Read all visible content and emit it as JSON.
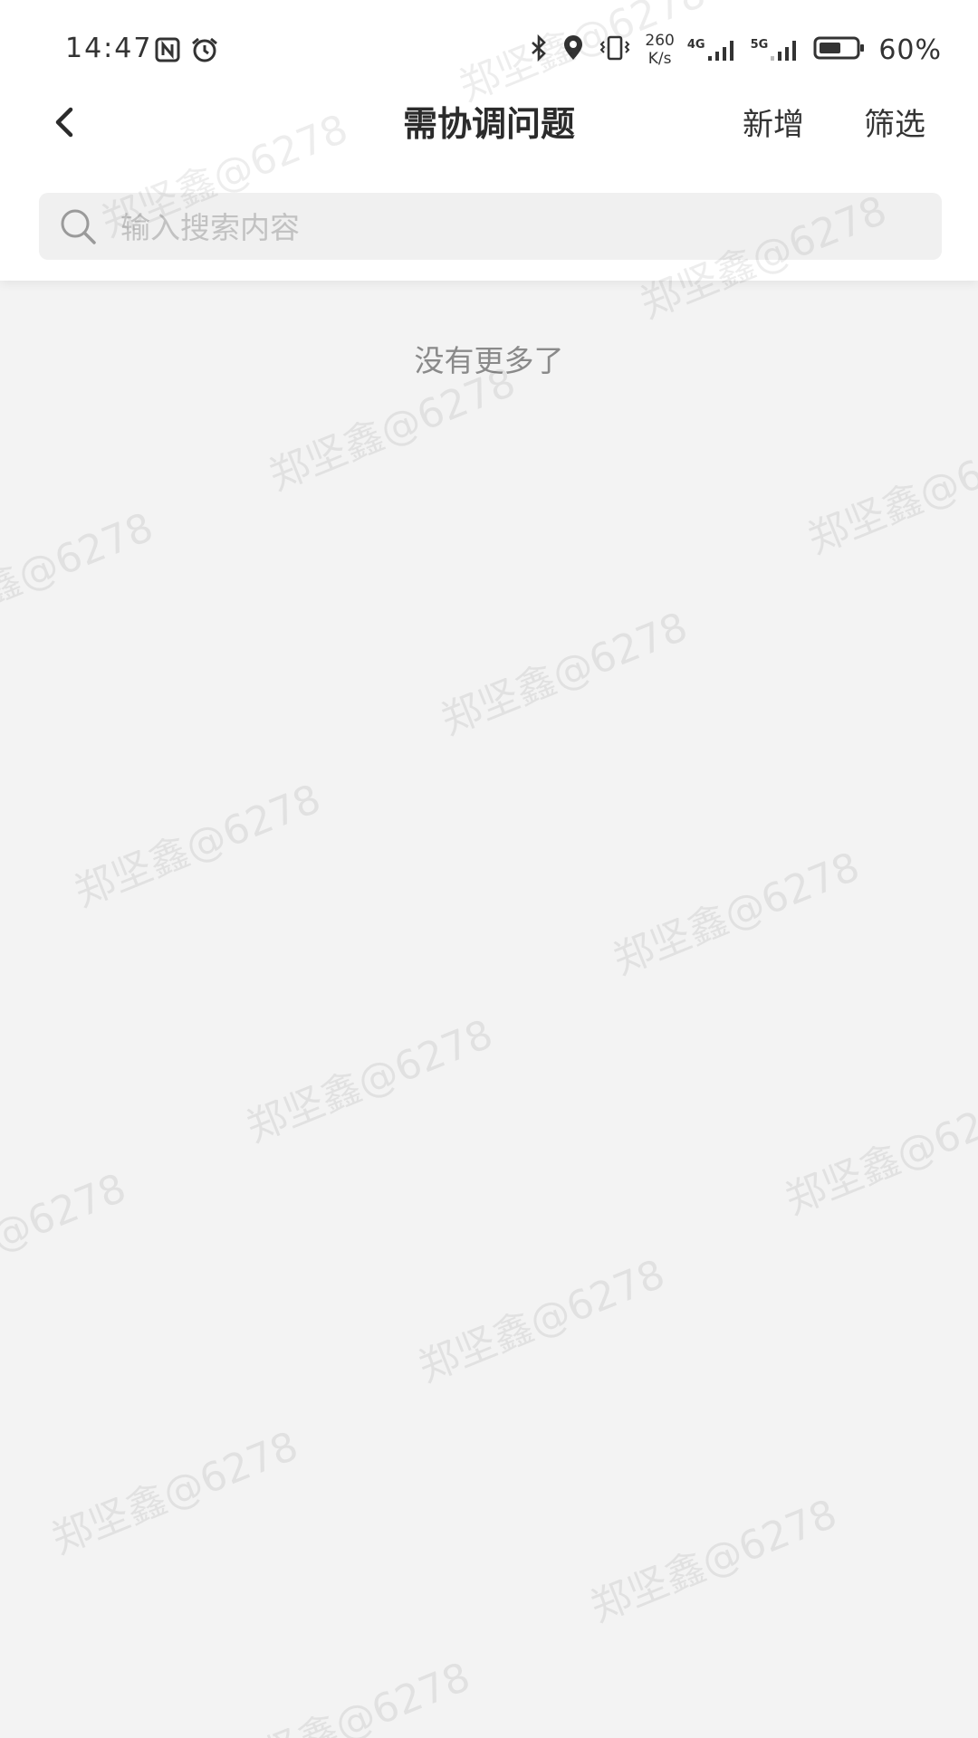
{
  "status_bar": {
    "time": "14:47",
    "net_speed_value": "260",
    "net_speed_unit": "K/s",
    "net_1": "4G",
    "net_2": "5G",
    "battery_percent": "60%",
    "battery_level": 0.6,
    "icons": [
      "nfc-icon",
      "alarm-icon",
      "bluetooth-icon",
      "location-icon",
      "vibrate-icon",
      "signal-icon",
      "battery-icon"
    ]
  },
  "nav": {
    "title": "需协调问题",
    "add_label": "新增",
    "filter_label": "筛选"
  },
  "search": {
    "placeholder": "输入搜索内容",
    "value": ""
  },
  "list": {
    "end_message": "没有更多了"
  },
  "watermark": {
    "text": "郑坚鑫@6278"
  }
}
